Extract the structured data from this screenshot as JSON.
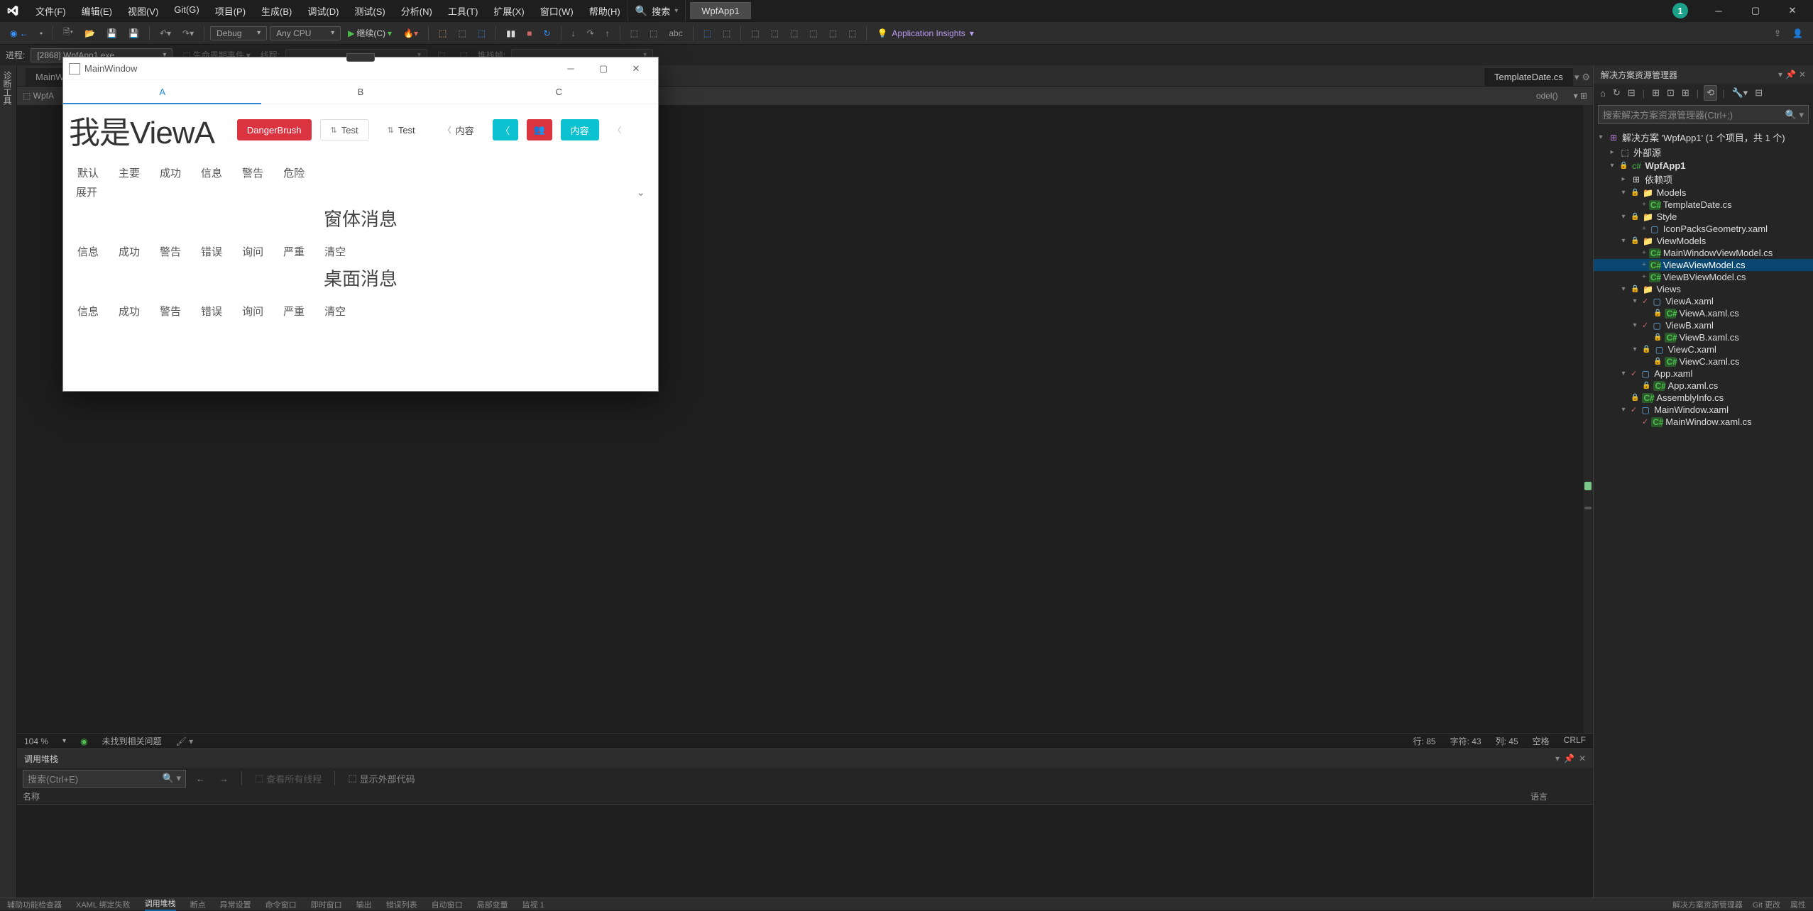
{
  "menu": {
    "file": "文件(F)",
    "edit": "编辑(E)",
    "view": "视图(V)",
    "git": "Git(G)",
    "project": "项目(P)",
    "build": "生成(B)",
    "debug": "调试(D)",
    "test": "测试(S)",
    "analyze": "分析(N)",
    "tools": "工具(T)",
    "ext": "扩展(X)",
    "window": "窗口(W)",
    "help": "帮助(H)"
  },
  "search_label": "搜索",
  "app_tab": "WpfApp1",
  "notif_badge": "1",
  "toolbar": {
    "config": "Debug",
    "platform": "Any CPU",
    "continue": "继续(C)",
    "insights": "Application Insights"
  },
  "toolbar2": {
    "process": "进程:",
    "process_val": "[2868] WpfApp1.exe",
    "lifecycle": "生命周期事件",
    "thread": "线程:",
    "stackframe": "堆栈帧:"
  },
  "doc_tabs": {
    "left": "MainW",
    "right": "TemplateDate.cs"
  },
  "nav": {
    "scope": "WpfA",
    "path": "odel()"
  },
  "editor_status": {
    "zoom": "104 %",
    "issues": "未找到相关问题",
    "line": "行: 85",
    "char": "字符: 43",
    "col": "列: 45",
    "ws": "空格",
    "eol": "CRLF"
  },
  "callstack": {
    "title": "调用堆栈",
    "search_ph": "搜索(Ctrl+E)",
    "view_threads": "查看所有线程",
    "show_ext": "显示外部代码",
    "col_name": "名称",
    "col_lang": "语言"
  },
  "sxp": {
    "title": "解决方案资源管理器",
    "search_ph": "搜索解决方案资源管理器(Ctrl+;)",
    "root": "解决方案 'WpfApp1' (1 个项目，共 1 个)",
    "external": "外部源",
    "project": "WpfApp1",
    "deps": "依赖项",
    "models": "Models",
    "template": "TemplateDate.cs",
    "style": "Style",
    "iconpacks": "IconPacksGeometry.xaml",
    "viewmodels": "ViewModels",
    "mwvm": "MainWindowViewModel.cs",
    "viewavm": "ViewAViewModel.cs",
    "viewbvm": "ViewBViewModel.cs",
    "views": "Views",
    "viewa": "ViewA.xaml",
    "viewacs": "ViewA.xaml.cs",
    "viewb": "ViewB.xaml",
    "viewbcs": "ViewB.xaml.cs",
    "viewc": "ViewC.xaml",
    "viewccs": "ViewC.xaml.cs",
    "appx": "App.xaml",
    "appxcs": "App.xaml.cs",
    "asm": "AssemblyInfo.cs",
    "mw": "MainWindow.xaml",
    "mwcs": "MainWindow.xaml.cs"
  },
  "statusbar": {
    "a11y": "辅助功能检查器",
    "xaml": "XAML 绑定失败",
    "callstack": "调用堆栈",
    "bp": "断点",
    "except": "异常设置",
    "cmd": "命令窗口",
    "imm": "即时窗口",
    "out": "输出",
    "err": "错误列表",
    "auto": "自动窗口",
    "locals": "局部变量",
    "watch": "监视 1",
    "sxp": "解决方案资源管理器",
    "gitchg": "Git 更改",
    "props": "属性"
  },
  "side_strip": "诊断工具",
  "wpf": {
    "title": "MainWindow",
    "tabs": {
      "a": "A",
      "b": "B",
      "c": "C"
    },
    "big": "我是ViewA",
    "danger": "DangerBrush",
    "test": "Test",
    "content": "内容",
    "row2": {
      "a": "默认",
      "b": "主要",
      "c": "成功",
      "d": "信息",
      "e": "警告",
      "f": "危险"
    },
    "expand": "展开",
    "sect1": "窗体消息",
    "sect2": "桌面消息",
    "msgrow": {
      "a": "信息",
      "b": "成功",
      "c": "警告",
      "d": "错误",
      "e": "询问",
      "f": "严重",
      "g": "清空"
    }
  }
}
